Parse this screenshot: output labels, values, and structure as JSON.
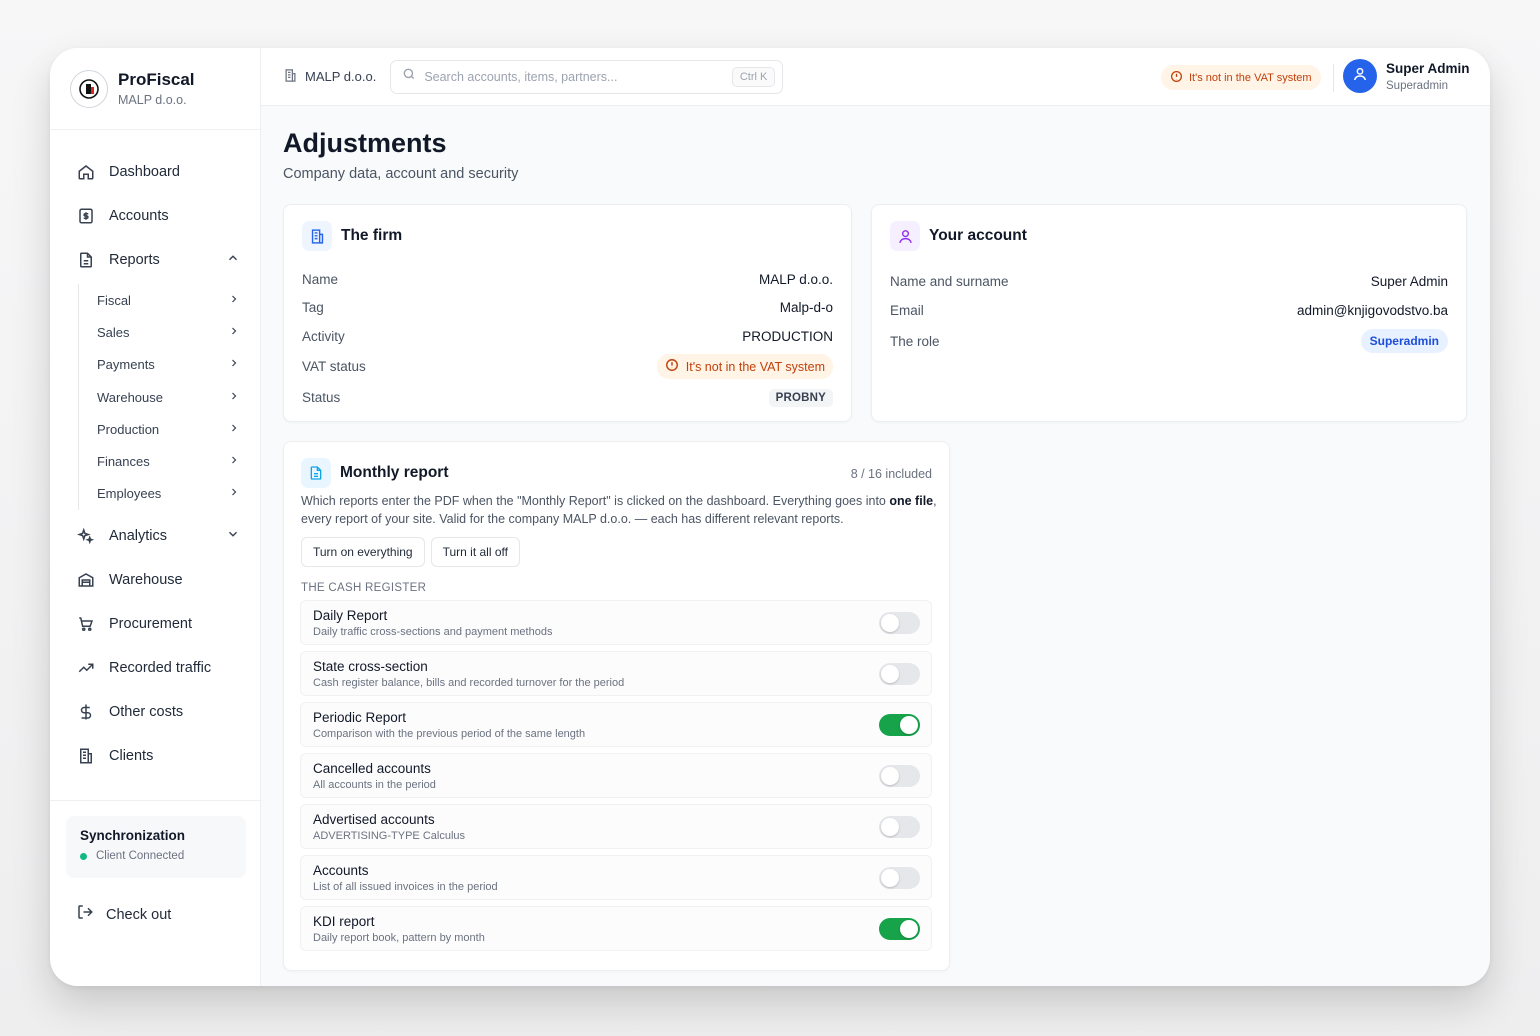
{
  "brand": {
    "name": "ProFiscal",
    "company": "MALP d.o.o."
  },
  "nav": {
    "dashboard": "Dashboard",
    "accounts": "Accounts",
    "reports": "Reports",
    "reports_sub": [
      "Fiscal",
      "Sales",
      "Payments",
      "Warehouse",
      "Production",
      "Finances",
      "Employees"
    ],
    "analytics": "Analytics",
    "warehouse": "Warehouse",
    "procurement": "Procurement",
    "recorded_traffic": "Recorded traffic",
    "other_costs": "Other costs",
    "clients": "Clients"
  },
  "sync": {
    "title": "Synchronization",
    "status": "Client Connected"
  },
  "logout": "Check out",
  "topbar": {
    "company": "MALP d.o.o.",
    "search_placeholder": "Search accounts, items, partners...",
    "shortcut": "Ctrl K",
    "vat_notice": "It's not in the VAT system",
    "user_name": "Super Admin",
    "user_role": "Superadmin"
  },
  "page": {
    "title": "Adjustments",
    "subtitle": "Company data, account and security"
  },
  "firm": {
    "title": "The firm",
    "fields": [
      {
        "label": "Name",
        "value": "MALP d.o.o."
      },
      {
        "label": "Tag",
        "value": "Malp-d-o"
      },
      {
        "label": "Activity",
        "value": "PRODUCTION"
      },
      {
        "label": "VAT status",
        "value": "It's not in the VAT system"
      },
      {
        "label": "Status",
        "value": "PROBNY"
      }
    ]
  },
  "account": {
    "title": "Your account",
    "fields": [
      {
        "label": "Name and surname",
        "value": "Super Admin"
      },
      {
        "label": "Email",
        "value": "admin@knjigovodstvo.ba"
      },
      {
        "label": "The role",
        "value": "Superadmin"
      }
    ]
  },
  "monthly": {
    "title": "Monthly report",
    "count": "8 / 16 included",
    "desc_part1": "Which reports enter the PDF when the \"Monthly Report\" is clicked on the dashboard. Everything goes into",
    "desc_bold": "one file",
    "desc_part2": ", every report of your site. Valid for the company MALP d.o.o. — each has different relevant reports.",
    "btn_on": "Turn on everything",
    "btn_off": "Turn it all off",
    "section": "THE CASH REGISTER",
    "reports": [
      {
        "title": "Daily Report",
        "desc": "Daily traffic cross-sections and payment methods",
        "on": false
      },
      {
        "title": "State cross-section",
        "desc": "Cash register balance, bills and recorded turnover for the period",
        "on": false
      },
      {
        "title": "Periodic Report",
        "desc": "Comparison with the previous period of the same length",
        "on": true
      },
      {
        "title": "Cancelled accounts",
        "desc": "All accounts in the period",
        "on": false
      },
      {
        "title": "Advertised accounts",
        "desc": "ADVERTISING-TYPE Calculus",
        "on": false
      },
      {
        "title": "Accounts",
        "desc": "List of all issued invoices in the period",
        "on": false
      },
      {
        "title": "KDI report",
        "desc": "Daily report book, pattern by month",
        "on": true
      }
    ]
  },
  "colors": {
    "accent": "#2563eb",
    "toggle_on": "#16a34a",
    "warning": "#c2410c"
  }
}
